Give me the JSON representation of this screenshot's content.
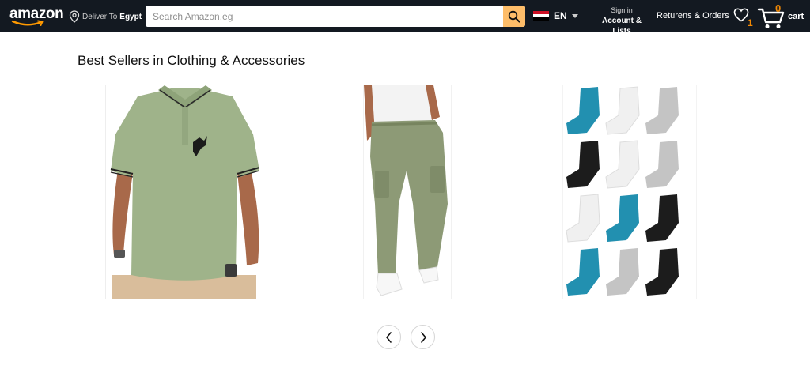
{
  "header": {
    "logo_text": "amazon",
    "deliver_prefix": "Deliver To",
    "deliver_location": "Egypt",
    "search_placeholder": "Search Amazon.eg",
    "language": "EN",
    "signin_line1": "Sign in",
    "signin_line2": "Account & Lists",
    "returns_label": "Returens & Orders",
    "wishlist_count": "1",
    "cart_count": "0",
    "cart_label": "cart"
  },
  "colors": {
    "header_bg": "#131921",
    "search_button": "#febd69",
    "accent_count": "#f08804",
    "flag_red": "#ce1126",
    "flag_white": "#ffffff",
    "flag_black": "#000000"
  },
  "icons": {
    "logo_smile": "amazon-smile-icon",
    "location": "location-pin-icon",
    "search": "search-icon",
    "flag": "egypt-flag-icon",
    "wishlist": "heart-icon",
    "cart": "cart-icon",
    "prev": "chevron-left-icon",
    "next": "chevron-right-icon"
  },
  "main": {
    "section_title": "Best Sellers in Clothing & Accessories",
    "products": [
      {
        "image": "green polo shirt"
      },
      {
        "image": "olive cargo pants"
      },
      {
        "image": "ankle socks pack"
      }
    ]
  }
}
